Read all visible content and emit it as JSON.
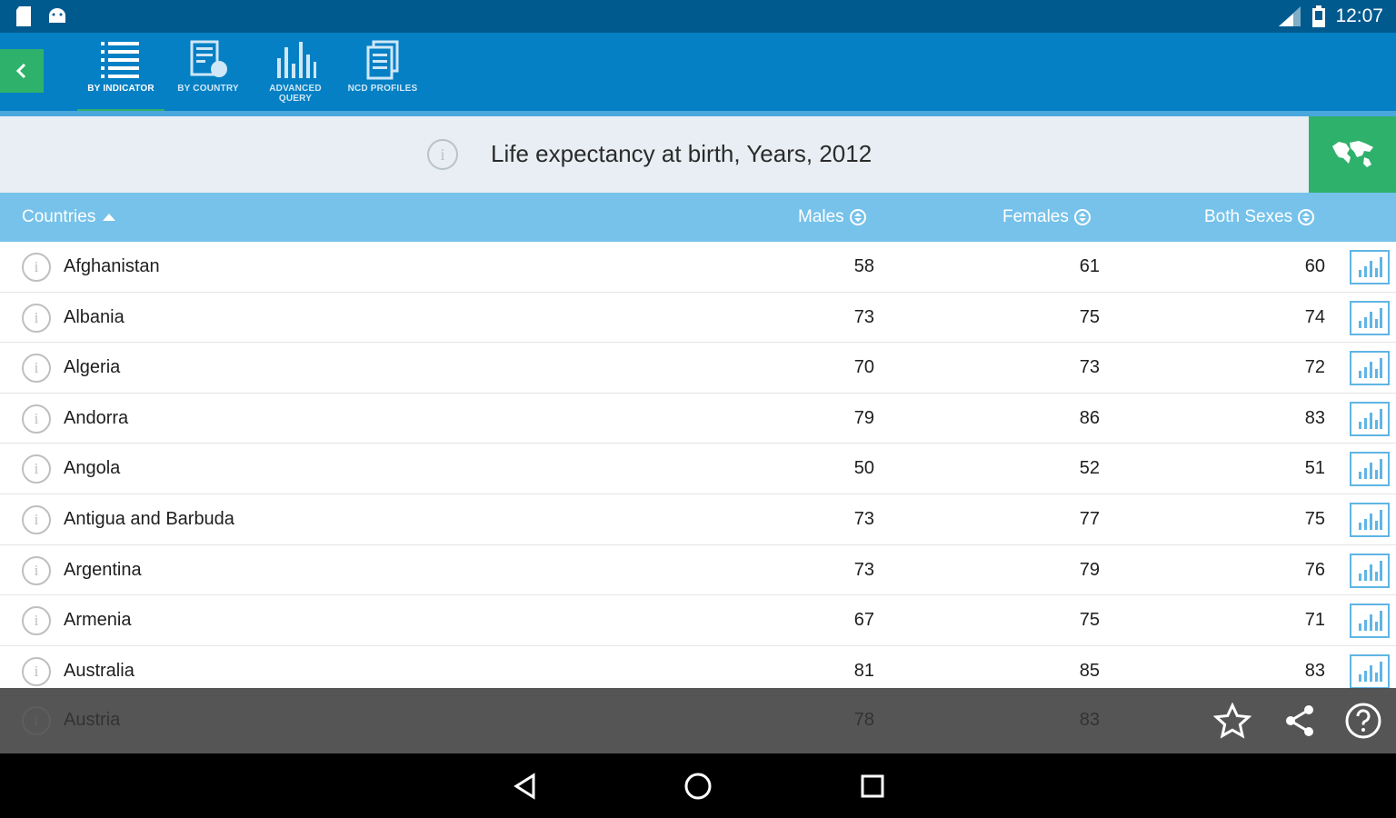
{
  "status_bar": {
    "time": "12:07",
    "icons": [
      "sd-card-icon",
      "android-icon",
      "signal-icon",
      "battery-icon"
    ]
  },
  "toolbar": {
    "back_label": "‹",
    "tabs": [
      {
        "label": "BY INDICATOR",
        "icon": "list-icon",
        "active": true
      },
      {
        "label": "BY COUNTRY",
        "icon": "country-doc-icon",
        "active": false
      },
      {
        "label": "ADVANCED QUERY",
        "icon": "bar-chart-icon",
        "active": false
      },
      {
        "label": "NCD PROFILES",
        "icon": "profiles-icon",
        "active": false
      }
    ]
  },
  "indicator": {
    "title": "Life expectancy at birth, Years, 2012",
    "info_glyph": "i"
  },
  "table": {
    "columns": {
      "countries": "Countries",
      "males": "Males",
      "females": "Females",
      "both": "Both Sexes"
    },
    "rows": [
      {
        "country": "Afghanistan",
        "males": "58",
        "females": "61",
        "both": "60"
      },
      {
        "country": "Albania",
        "males": "73",
        "females": "75",
        "both": "74"
      },
      {
        "country": "Algeria",
        "males": "70",
        "females": "73",
        "both": "72"
      },
      {
        "country": "Andorra",
        "males": "79",
        "females": "86",
        "both": "83"
      },
      {
        "country": "Angola",
        "males": "50",
        "females": "52",
        "both": "51"
      },
      {
        "country": "Antigua and Barbuda",
        "males": "73",
        "females": "77",
        "both": "75"
      },
      {
        "country": "Argentina",
        "males": "73",
        "females": "79",
        "both": "76"
      },
      {
        "country": "Armenia",
        "males": "67",
        "females": "75",
        "both": "71"
      },
      {
        "country": "Australia",
        "males": "81",
        "females": "85",
        "both": "83"
      }
    ],
    "partial_row": {
      "country": "Austria",
      "males": "78",
      "females": "83"
    }
  },
  "colors": {
    "status_bar": "#005a8e",
    "toolbar": "#0580c4",
    "accent_green": "#2eb16b",
    "header": "#76c2ea"
  }
}
